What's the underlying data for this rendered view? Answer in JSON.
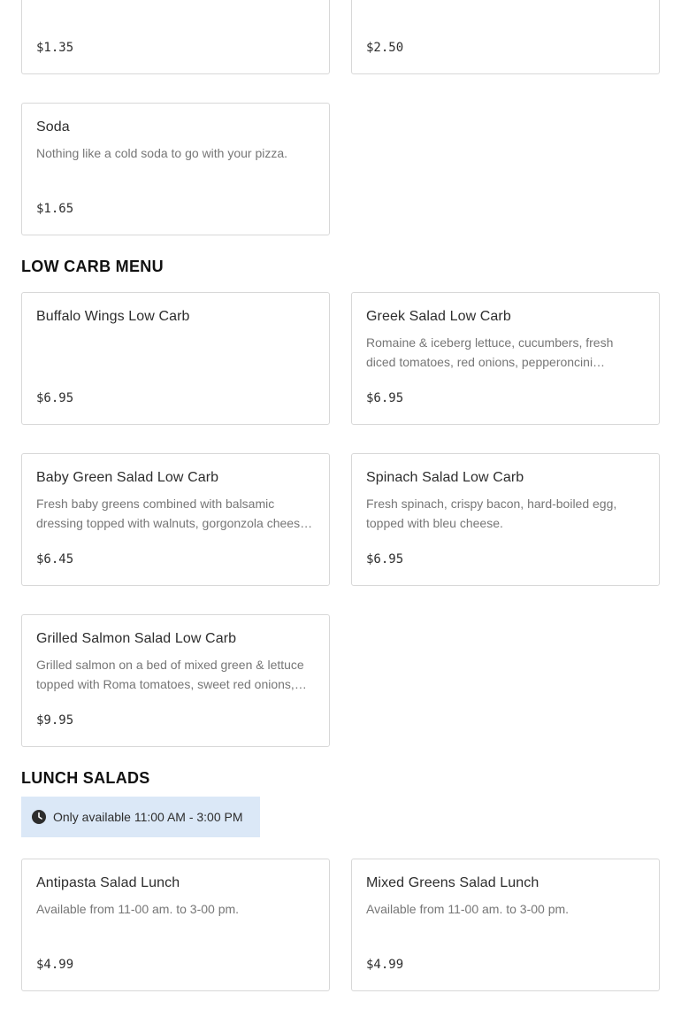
{
  "sections": {
    "beverages": {
      "items": [
        {
          "name": "",
          "description": "",
          "price": "$1.35"
        },
        {
          "name": "",
          "description": "",
          "price": "$2.50"
        },
        {
          "name": "Soda",
          "description": "Nothing like a cold soda to go with your pizza.",
          "price": "$1.65"
        }
      ]
    },
    "low_carb": {
      "title": "LOW CARB MENU",
      "items": [
        {
          "name": "Buffalo Wings Low Carb",
          "description": "",
          "price": "$6.95"
        },
        {
          "name": "Greek Salad Low Carb",
          "description": "Romaine & iceberg lettuce, cucumbers, fresh diced tomatoes, red onions, pepperoncini…",
          "price": "$6.95"
        },
        {
          "name": "Baby Green Salad Low Carb",
          "description": "Fresh baby greens combined with balsamic dressing topped with walnuts, gorgonzola chees…",
          "price": "$6.45"
        },
        {
          "name": "Spinach Salad Low Carb",
          "description": "Fresh spinach, crispy bacon, hard-boiled egg, topped with bleu cheese.",
          "price": "$6.95"
        },
        {
          "name": "Grilled Salmon Salad Low Carb",
          "description": "Grilled salmon on a bed of mixed green & lettuce topped with Roma tomatoes, sweet red onions,…",
          "price": "$9.95"
        }
      ]
    },
    "lunch_salads": {
      "title": "LUNCH SALADS",
      "availability": "Only available 11:00 AM - 3:00 PM",
      "availability_icon": "clock-icon",
      "items": [
        {
          "name": "Antipasta Salad Lunch",
          "description": "Available from 11-00 am. to 3-00 pm.",
          "price": "$4.99"
        },
        {
          "name": "Mixed Greens Salad Lunch",
          "description": "Available from 11-00 am. to 3-00 pm.",
          "price": "$4.99"
        }
      ]
    }
  },
  "colors": {
    "notice_background": "#dbe8f7",
    "card_border": "#d8d8d8",
    "description_text": "#767676"
  }
}
